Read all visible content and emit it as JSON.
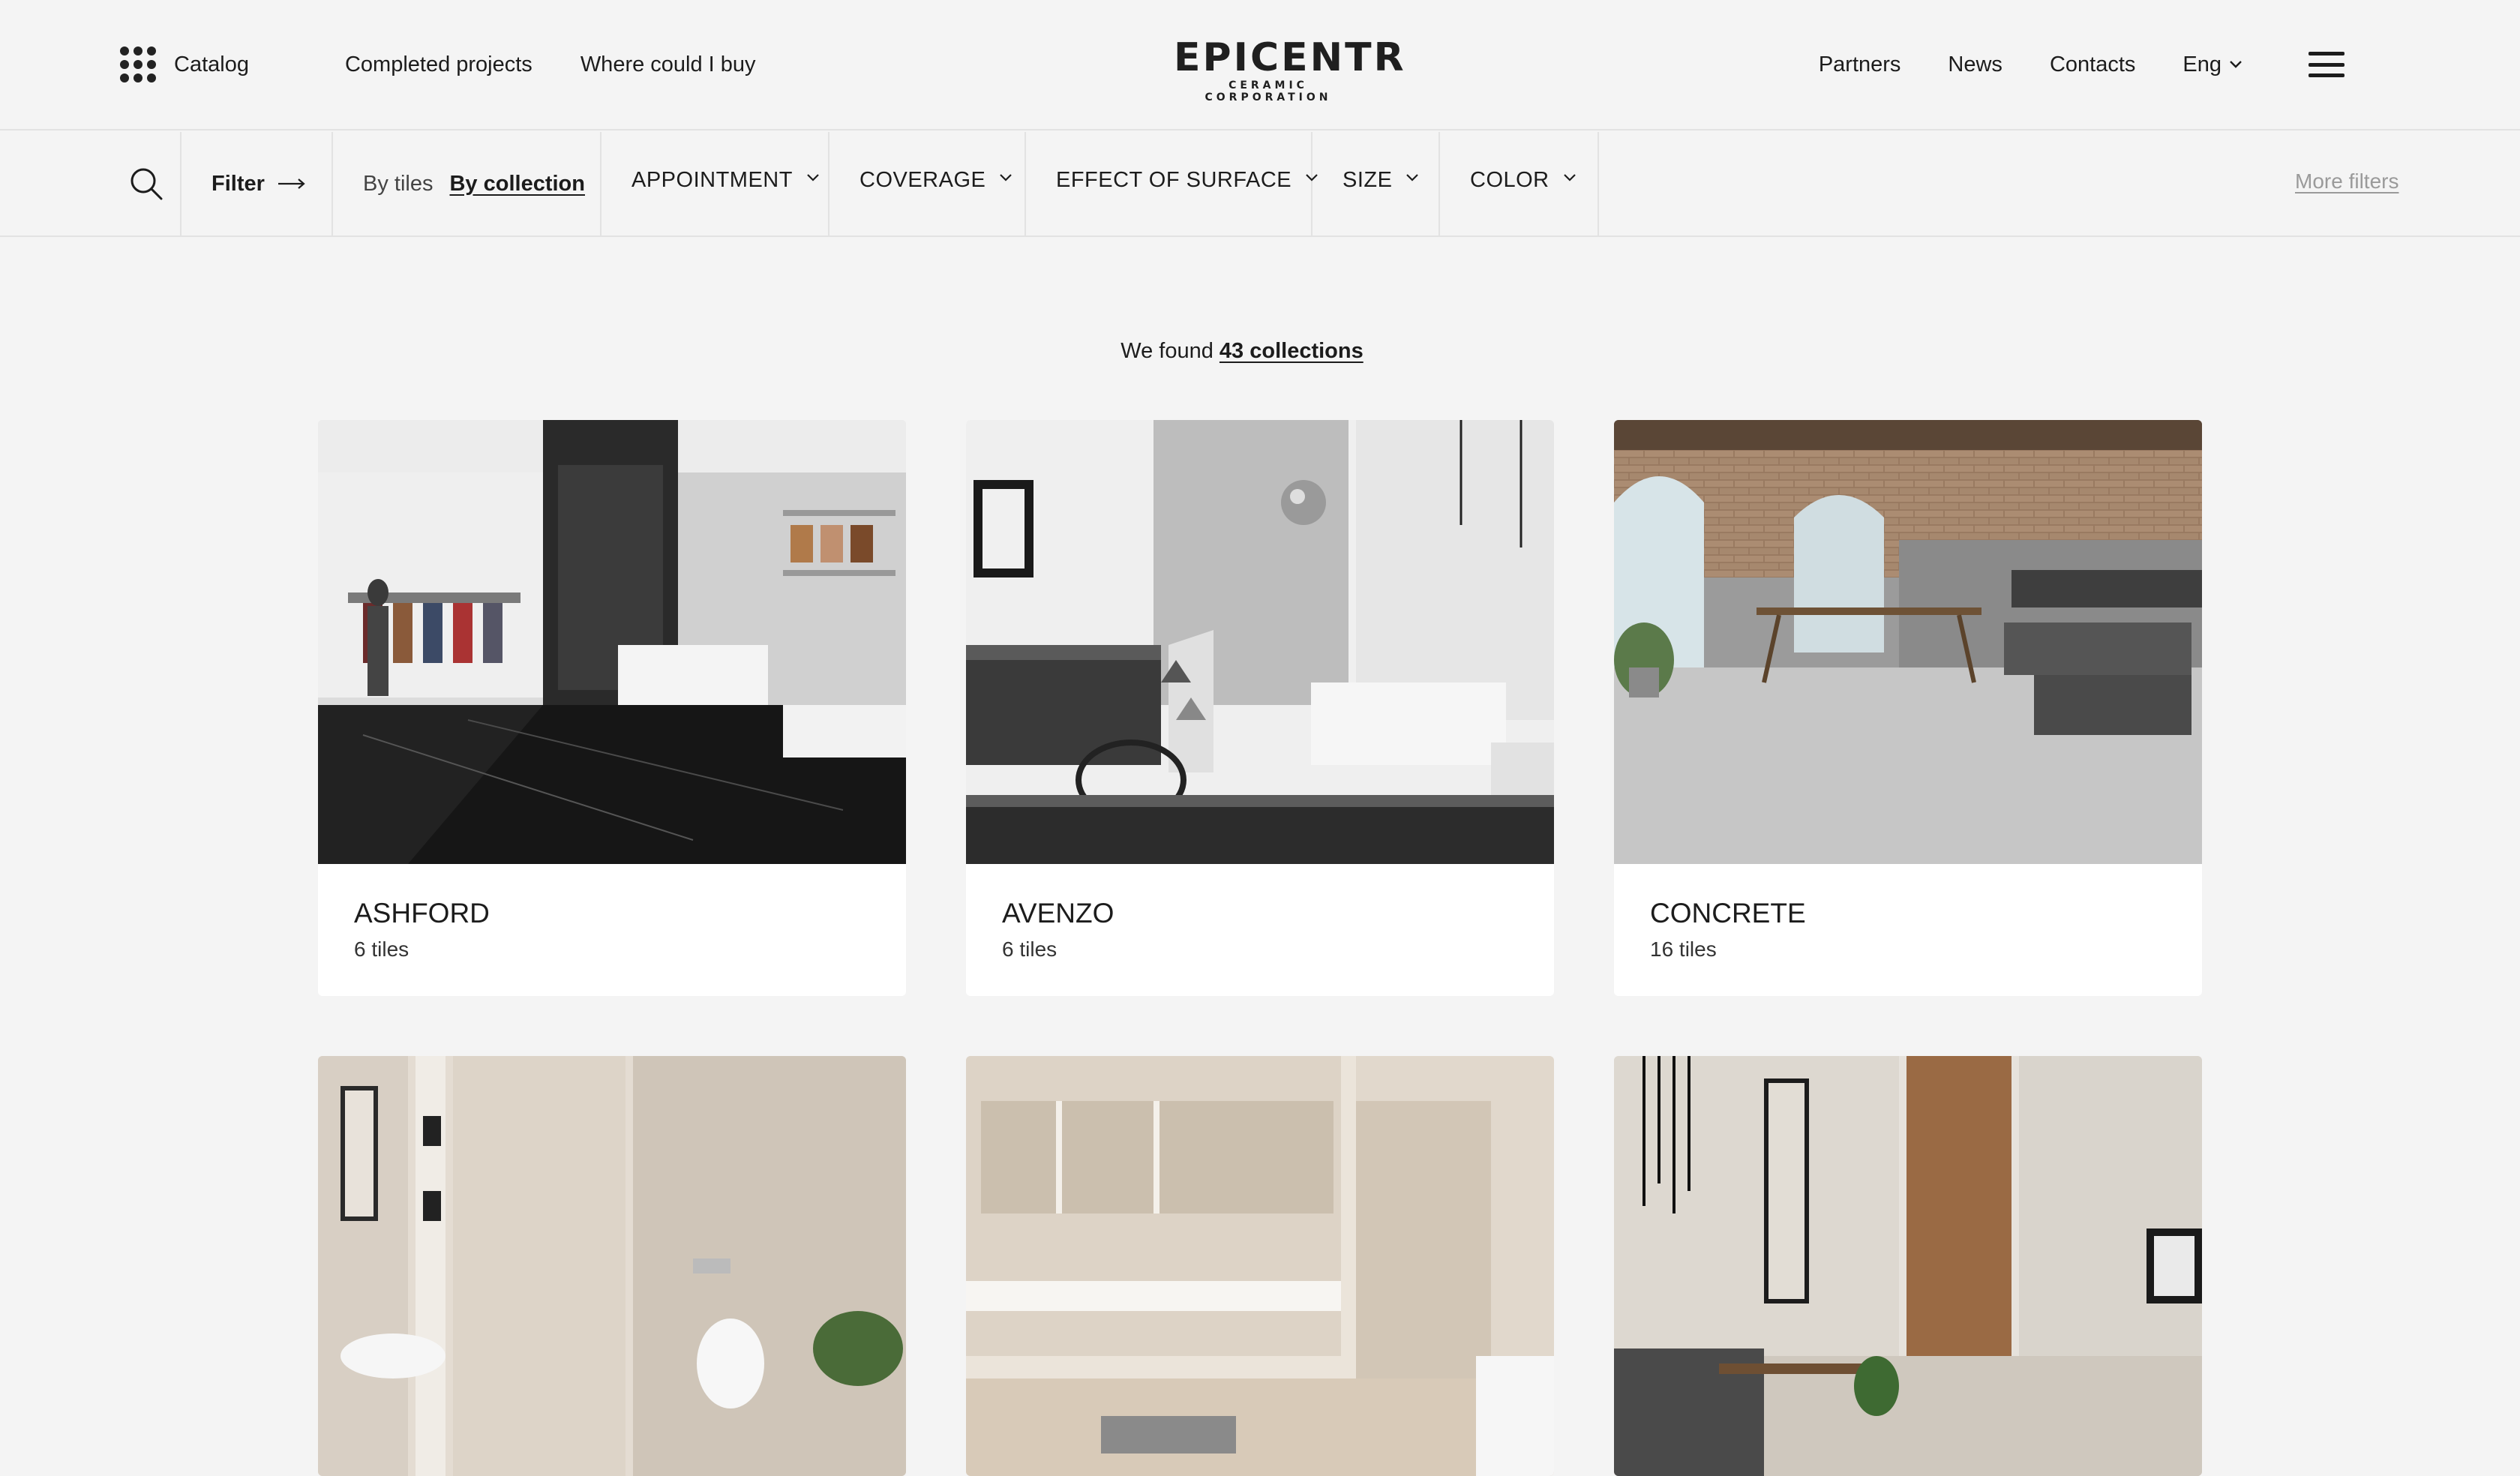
{
  "header": {
    "catalog_label": "Catalog",
    "nav_left": [
      "Completed projects",
      "Where could I buy"
    ],
    "logo_main": "EPICENTR",
    "logo_sub": "CERAMIC CORPORATION",
    "nav_right": [
      "Partners",
      "News",
      "Contacts"
    ],
    "language": "Eng"
  },
  "filters": {
    "filter_label": "Filter",
    "mode_tiles": "By tiles",
    "mode_collection": "By collection",
    "dropdowns": [
      "APPOINTMENT",
      "COVERAGE",
      "EFFECT OF SURFACE",
      "SIZE",
      "COLOR"
    ],
    "more_filters": "More filters"
  },
  "results": {
    "found_prefix": "We found",
    "found_count": "43 collections"
  },
  "collections": [
    {
      "title": "ASHFORD",
      "tiles": "6 tiles"
    },
    {
      "title": "AVENZO",
      "tiles": "6 tiles"
    },
    {
      "title": "CONCRETE",
      "tiles": "16 tiles"
    }
  ],
  "colors": {
    "background": "#f4f4f4",
    "card": "#ffffff",
    "text": "#1c1c1c",
    "muted_link": "#9a9a9a",
    "divider": "#e2e2e2"
  }
}
